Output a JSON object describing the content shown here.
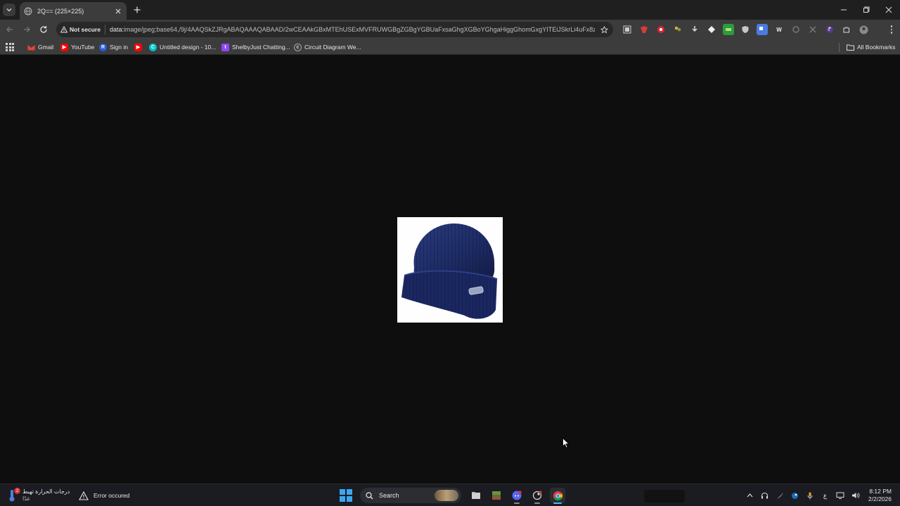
{
  "browser": {
    "tab": {
      "title": "2Q== (225×225)"
    },
    "omnibox": {
      "security_label": "Not secure",
      "url_scheme": "data:",
      "url_rest": "image/jpeg;base64,/9j/4AAQSkZJRgABAQAAAQABAAD/2wCEAAkGBxMTEhUSExMVFRUWGBgZGBgYGBUaFxsaGhgXGBoYGhgaHiggGhomGxgYITEiJSkrLi4uFx8zOD..."
    },
    "bookmarks": [
      {
        "label": "Gmail",
        "icon": "gmail-icon",
        "color": "#ea4335"
      },
      {
        "label": "YouTube",
        "icon": "youtube-icon",
        "color": "#ff0000"
      },
      {
        "label": "Sign in",
        "icon": "r-icon",
        "color": "#2a5bd7"
      },
      {
        "label": "",
        "icon": "youtube-icon",
        "color": "#ff0000"
      },
      {
        "label": "Untitled design - 10...",
        "icon": "canva-icon",
        "color": "#00c4cc"
      },
      {
        "label": "ShelbyJust Chatting...",
        "icon": "twitch-icon",
        "color": "#9146ff"
      },
      {
        "label": "Circuit Diagram We...",
        "icon": "circuit-icon",
        "color": "#444444"
      }
    ],
    "all_bookmarks_label": "All Bookmarks"
  },
  "content": {
    "image_alt": "navy blue knit beanie hat"
  },
  "taskbar": {
    "weather_line1": "درجات الحرارة تهبط",
    "weather_line2": "غدًا",
    "weather_badge": "2",
    "error_text": "Error occured",
    "search_label": "Search",
    "tray_lang": "ع",
    "time": "8:12 PM",
    "date": "2/2/2026"
  },
  "colors": {
    "accent": "#3ba7f4",
    "page_bg": "#0e0e0e",
    "beanie": "#1d2b63"
  }
}
